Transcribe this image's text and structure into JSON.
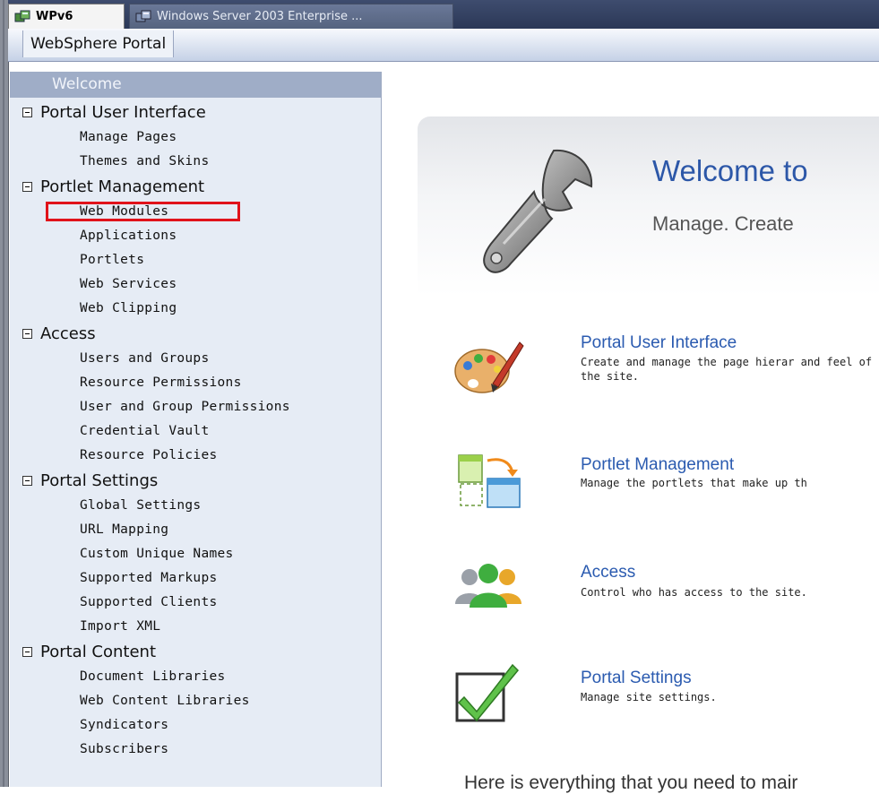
{
  "tabs": [
    {
      "label": "WPv6",
      "active": true,
      "icon": "server-icon"
    },
    {
      "label": "Windows Server 2003 Enterprise ...",
      "active": false,
      "icon": "server-icon"
    }
  ],
  "portal": {
    "title": "WebSphere Portal"
  },
  "sidebar": {
    "welcome": "Welcome",
    "sections": [
      {
        "label": "Portal User Interface",
        "items": [
          "Manage Pages",
          "Themes and Skins"
        ]
      },
      {
        "label": "Portlet Management",
        "items": [
          "Web Modules",
          "Applications",
          "Portlets",
          "Web Services",
          "Web Clipping"
        ]
      },
      {
        "label": "Access",
        "items": [
          "Users and Groups",
          "Resource Permissions",
          "User and Group Permissions",
          "Credential Vault",
          "Resource Policies"
        ]
      },
      {
        "label": "Portal Settings",
        "items": [
          "Global Settings",
          "URL Mapping",
          "Custom Unique Names",
          "Supported Markups",
          "Supported Clients",
          "Import XML"
        ]
      },
      {
        "label": "Portal Content",
        "items": [
          "Document Libraries",
          "Web Content Libraries",
          "Syndicators",
          "Subscribers"
        ]
      }
    ],
    "highlighted_item": "Web Modules"
  },
  "main": {
    "hero_title": "Welcome to",
    "hero_subtitle": "Manage. Create",
    "features": [
      {
        "title": "Portal User Interface",
        "desc": "Create and manage the page hierar and feel of the site.",
        "icon": "palette-icon"
      },
      {
        "title": "Portlet Management",
        "desc": "Manage the portlets that make up th",
        "icon": "portlet-layout-icon"
      },
      {
        "title": "Access",
        "desc": "Control who has access to the site.",
        "icon": "users-group-icon"
      },
      {
        "title": "Portal Settings",
        "desc": "Manage site settings.",
        "icon": "checkbox-check-icon"
      }
    ],
    "footer": "Here is everything that you need to mair"
  },
  "colors": {
    "accent": "#2b5bb0",
    "highlight_border": "#e0121a",
    "sidebar_bg": "#e6ecf5",
    "welcome_bg": "#9fadc7"
  }
}
